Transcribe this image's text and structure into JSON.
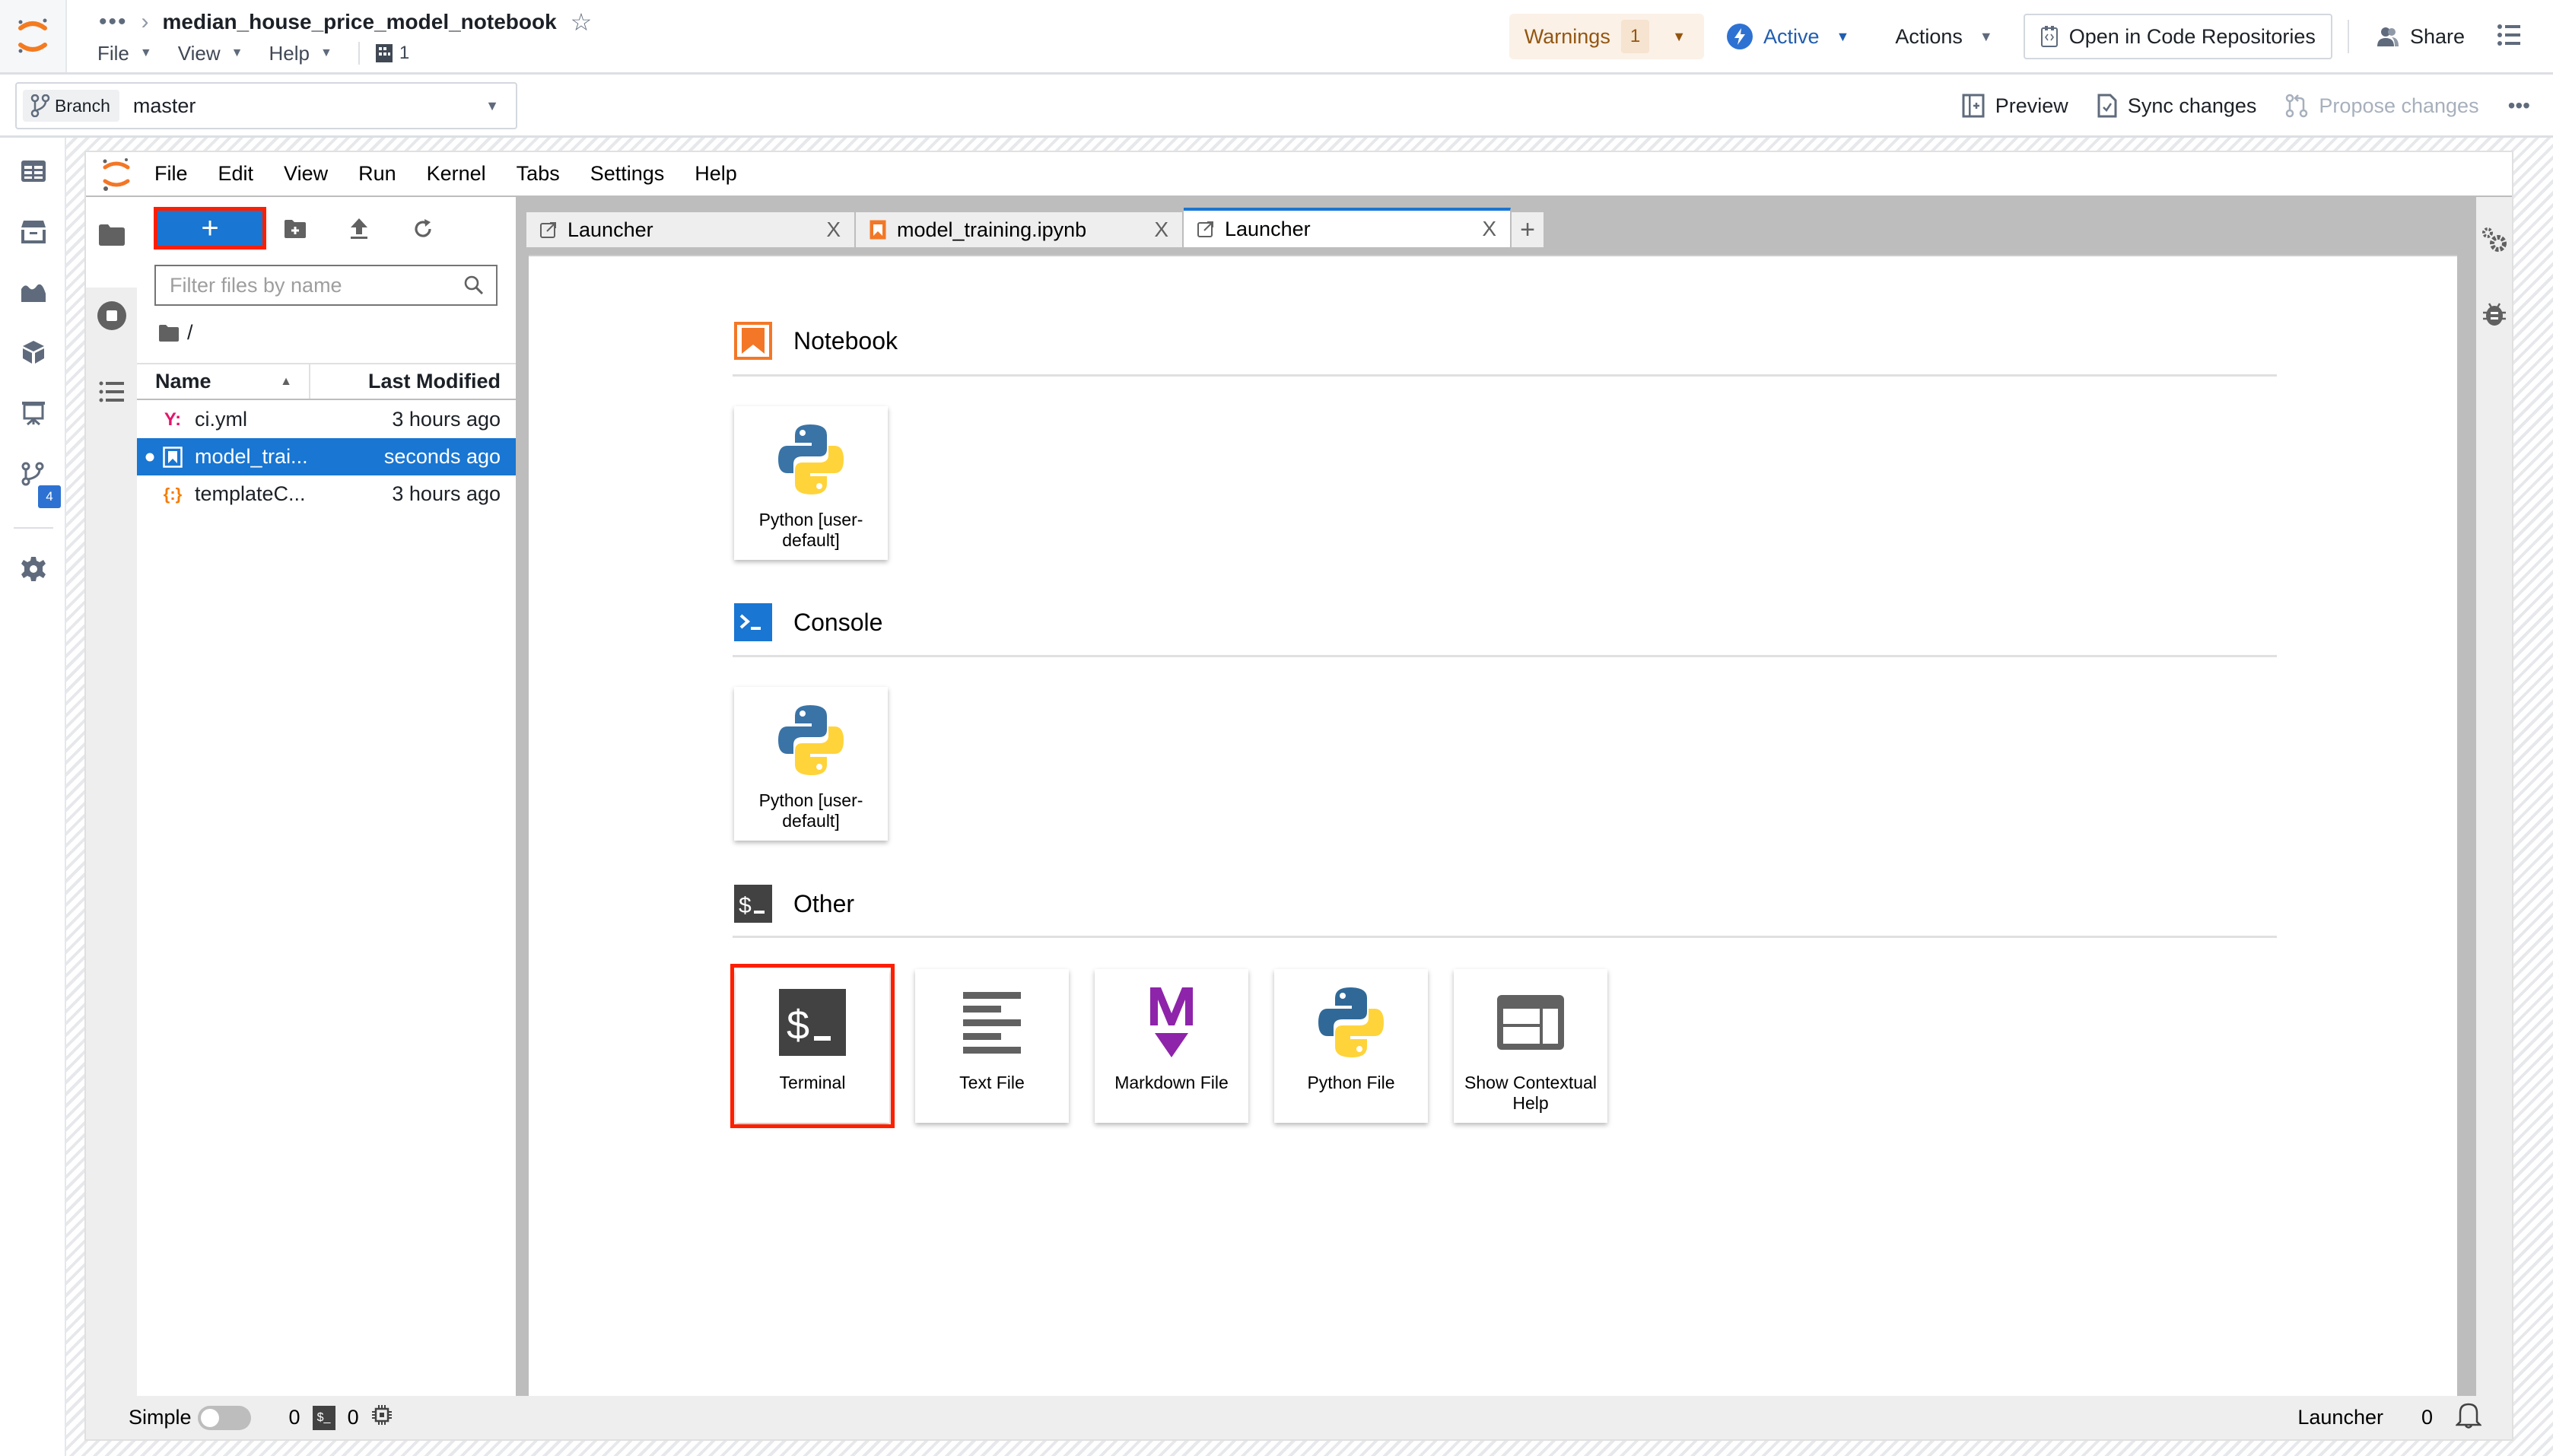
{
  "header": {
    "breadcrumb_more": "•••",
    "title": "median_house_price_model_notebook",
    "menus": [
      {
        "label": "File"
      },
      {
        "label": "View"
      },
      {
        "label": "Help"
      }
    ],
    "project_count": "1",
    "warnings_label": "Warnings",
    "warnings_count": "1",
    "status_label": "Active",
    "actions_label": "Actions",
    "open_repo_label": "Open in Code Repositories",
    "share_label": "Share"
  },
  "toolbar": {
    "branch_tag": "Branch",
    "branch_value": "master",
    "preview_label": "Preview",
    "sync_label": "Sync changes",
    "propose_label": "Propose changes",
    "more_label": "•••"
  },
  "left_rail": {
    "git_badge": "4"
  },
  "jupyter": {
    "menus": [
      "File",
      "Edit",
      "View",
      "Run",
      "Kernel",
      "Tabs",
      "Settings",
      "Help"
    ],
    "filebrowser": {
      "new_label": "+",
      "filter_placeholder": "Filter files by name",
      "path": "/",
      "col_name": "Name",
      "col_modified": "Last Modified",
      "files": [
        {
          "name": "ci.yml",
          "modified": "3 hours ago",
          "type": "yaml",
          "selected": false
        },
        {
          "name": "model_trai...",
          "modified": "seconds ago",
          "type": "notebook",
          "selected": true
        },
        {
          "name": "templateC...",
          "modified": "3 hours ago",
          "type": "json",
          "selected": false
        }
      ]
    },
    "tabs": [
      {
        "label": "Launcher",
        "icon": "launcher",
        "active": false
      },
      {
        "label": "model_training.ipynb",
        "icon": "notebook",
        "active": false
      },
      {
        "label": "Launcher",
        "icon": "launcher",
        "active": true
      }
    ],
    "tab_close": "X",
    "tab_add": "+",
    "launcher": {
      "sections": [
        {
          "title": "Notebook",
          "cards": [
            {
              "label": "Python [user-default]"
            }
          ]
        },
        {
          "title": "Console",
          "cards": [
            {
              "label": "Python [user-default]"
            }
          ]
        },
        {
          "title": "Other",
          "cards": [
            {
              "label": "Terminal"
            },
            {
              "label": "Text File"
            },
            {
              "label": "Markdown File"
            },
            {
              "label": "Python File"
            },
            {
              "label": "Show Contextual Help"
            }
          ]
        }
      ]
    },
    "statusbar": {
      "simple_label": "Simple",
      "kernels_count": "0",
      "terminals_count": "0",
      "current": "Launcher",
      "notifications": "0"
    }
  },
  "colors": {
    "accent": "#1976d2",
    "highlight": "#ff1f00",
    "warning_text": "#935610",
    "active_blue": "#215db0"
  }
}
